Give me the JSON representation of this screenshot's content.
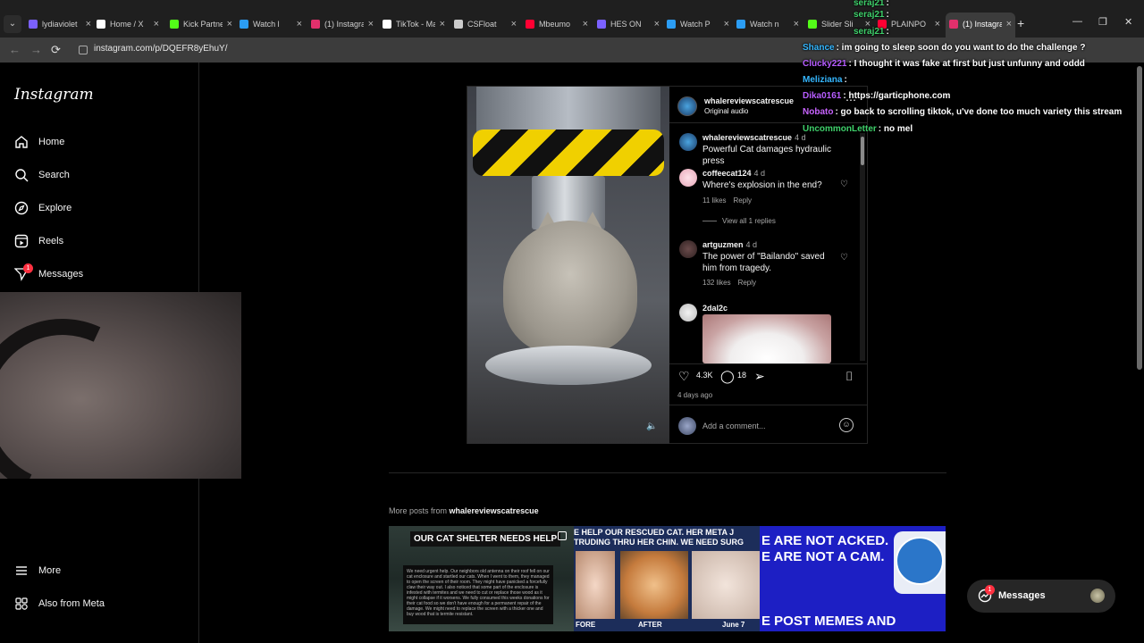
{
  "browser": {
    "tabs": [
      {
        "title": "lydiaviolet",
        "color": "#7b61ff"
      },
      {
        "title": "Home / X",
        "color": "#ffffff"
      },
      {
        "title": "Kick Partner",
        "color": "#53fc18"
      },
      {
        "title": "Watch l",
        "color": "#2b9df4"
      },
      {
        "title": "(1) Instagram",
        "color": "#e1306c"
      },
      {
        "title": "TikTok - Make",
        "color": "#ffffff"
      },
      {
        "title": "CSFloat",
        "color": "#cccccc"
      },
      {
        "title": "Mbeumo",
        "color": "#ff0033"
      },
      {
        "title": "HES ON",
        "color": "#7b61ff"
      },
      {
        "title": "Watch P",
        "color": "#2b9df4"
      },
      {
        "title": "Watch n",
        "color": "#2b9df4"
      },
      {
        "title": "Slider Sli",
        "color": "#53fc18"
      },
      {
        "title": "PLAINPO",
        "color": "#ff0033"
      },
      {
        "title": "(1) Instagram",
        "color": "#e1306c",
        "active": true
      }
    ],
    "url": "instagram.com/p/DQEFR8yEhuY/",
    "new_tab_label": "+",
    "back_label": "←",
    "forward_label": "→",
    "reload_label": "⟳"
  },
  "chat": [
    {
      "name": "seraj21",
      "text": ":",
      "color": "#3fd06b"
    },
    {
      "name": "seraj21",
      "text": ":",
      "color": "#3fd06b"
    },
    {
      "name": "seraj21",
      "text": ":",
      "color": "#3fd06b"
    },
    {
      "name": "Shance",
      "text": ": im going to sleep soon do you want to do the challenge ?",
      "color": "#35b7ff"
    },
    {
      "name": "Clucky221",
      "text": ": I thought it was fake at first but just unfunny and oddd",
      "color": "#b65cff"
    },
    {
      "name": "Meliziana",
      "text": ":",
      "color": "#35b7ff"
    },
    {
      "name": "Dika0161",
      "text": ": https://garticphone.com",
      "color": "#b65cff"
    },
    {
      "name": "Nobato",
      "text": ": go back to scrolling tiktok, u've done too much variety this stream",
      "color": "#c864ff"
    },
    {
      "name": "UncommonLetter",
      "text": ": no mel",
      "color": "#3fd06b"
    }
  ],
  "sidebar": {
    "logo": "Instagram",
    "items": [
      {
        "label": "Home",
        "icon": "home-icon"
      },
      {
        "label": "Search",
        "icon": "search-icon"
      },
      {
        "label": "Explore",
        "icon": "compass-icon"
      },
      {
        "label": "Reels",
        "icon": "reels-icon"
      },
      {
        "label": "Messages",
        "icon": "messenger-icon",
        "badge": "1"
      },
      {
        "label": "More",
        "icon": "hamburger-icon"
      },
      {
        "label": "Also from Meta",
        "icon": "meta-icon"
      }
    ]
  },
  "post": {
    "username": "whalereviewscatrescue",
    "audio": "Original audio",
    "caption_user": "whalereviewscatrescue",
    "caption_age": "4 d",
    "caption": "Powerful Cat damages hydraulic press",
    "comments": [
      {
        "user": "coffeecat124",
        "age": "4 d",
        "text": "Where's explosion in the end?",
        "likes": "11 likes",
        "reply": "Reply",
        "view_replies": "View all 1 replies"
      },
      {
        "user": "artguzmen",
        "age": "4 d",
        "text": "The power of \"Bailando\" saved him from tragedy.",
        "likes": "132 likes",
        "reply": "Reply"
      },
      {
        "user": "2dal2c",
        "age": ""
      }
    ],
    "like_count": "4.3K",
    "comment_count": "18",
    "time": "4 days ago",
    "add_comment_placeholder": "Add a comment..."
  },
  "more_posts": {
    "label_prefix": "More posts from",
    "label_user": "whalereviewscatrescue",
    "thumb1_heading": "OUR CAT SHELTER NEEDS HELP",
    "thumb1_body": "We need urgent help. Our neighbors old antenna on their roof fell on our cat enclosure and startled our cats. When I went to them, they managed to open the screen of their room. They might have panicked a forcefully claw their way out. I also noticed that some part of the enclosure is infested with termites and we need to cut or replace those wood as it might collapse if it worsens. We fully consumed this weeks donations for their cat food so we don't have enough for a permanent repair of the damage. We might need to replace the screen with a thicker one and buy wood that is termite resistant.",
    "thumb2_heading": "E HELP OUR RESCUED CAT. HER META J",
    "thumb2_heading2": "TRUDING THRU HER CHIN. WE NEED SURG",
    "thumb2_before": "FORE",
    "thumb2_after": "AFTER",
    "thumb2_date": "June 7",
    "thumb3_heading": "E ARE NOT ACKED. E ARE NOT A CAM.",
    "thumb3_heading2": "E POST MEMES AND"
  },
  "messages_pill": {
    "label": "Messages",
    "badge": "1"
  }
}
